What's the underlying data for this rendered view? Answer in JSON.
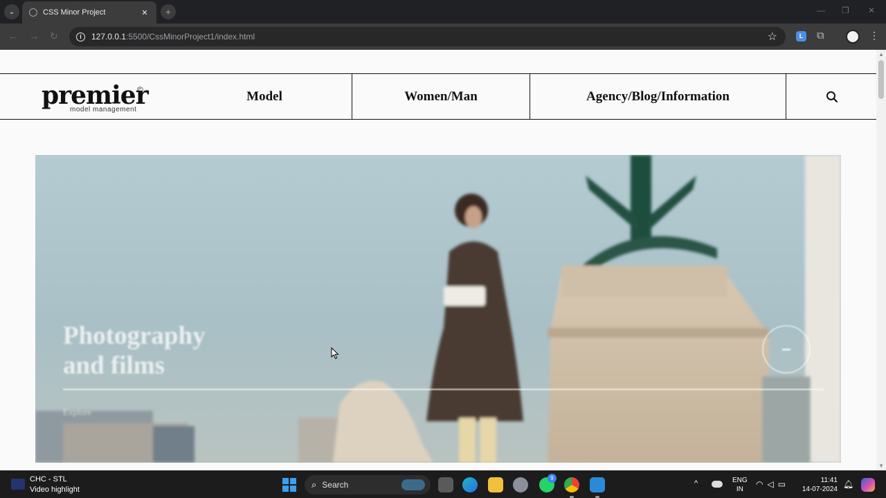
{
  "browser": {
    "tab_title": "CSS Minor Project",
    "tab_close": "✕",
    "new_tab": "+",
    "url_host": "127.0.0.1",
    "url_rest": ":5500/CssMinorProject1/index.html",
    "extension_badge": "L"
  },
  "site": {
    "logo_word": "premier",
    "logo_copyright": "©",
    "logo_sub": "model management",
    "nav": [
      "Model",
      "Women/Man",
      "Agency/Blog/Information"
    ]
  },
  "hero": {
    "title_line1": "Photography",
    "title_line2": "and films",
    "explore": "Explore"
  },
  "taskbar": {
    "weather_title": "CHC - STL",
    "weather_sub": "Video highlight",
    "search_label": "Search",
    "whatsapp_badge": "9",
    "lang_line1": "ENG",
    "lang_line2": "IN",
    "time": "11:41",
    "date": "14-07-2024"
  },
  "icons": {
    "tab_favicon": "globe-icon",
    "info": "info-icon",
    "bookmark": "star-icon",
    "search": "search-icon"
  },
  "colors": {
    "chrome_dark": "#202124",
    "page_bg": "#fafafa",
    "text": "#111111",
    "windows_accent": "#3aa0f0"
  }
}
